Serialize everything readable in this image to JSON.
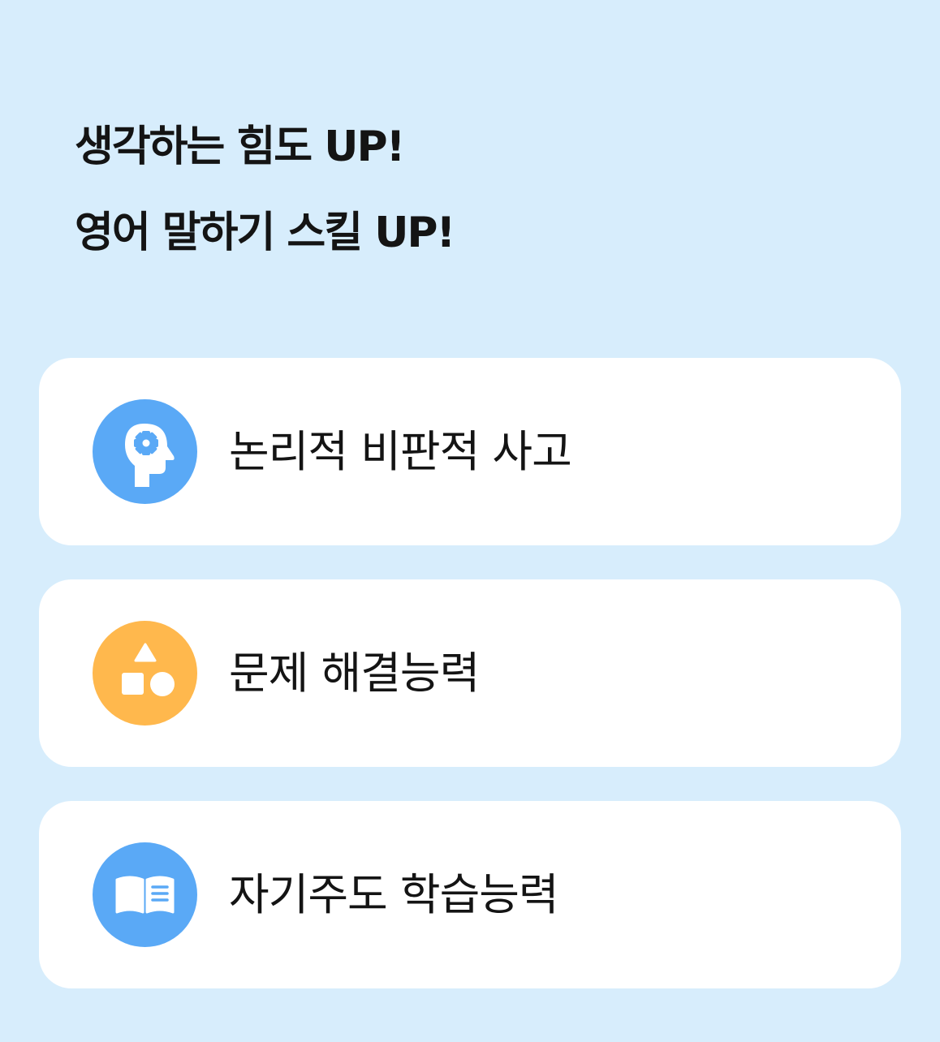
{
  "headline": {
    "line1": "생각하는 힘도 UP!",
    "line2": "영어 말하기 스킬 UP!"
  },
  "colors": {
    "background": "#d7edfc",
    "card": "#ffffff",
    "blue_icon": "#5aa9f6",
    "orange_icon": "#ffb84d"
  },
  "features": [
    {
      "label": "논리적 비판적 사고",
      "icon": "head-gear-icon",
      "color": "#5aa9f6"
    },
    {
      "label": "문제 해결능력",
      "icon": "shapes-icon",
      "color": "#ffb84d"
    },
    {
      "label": "자기주도 학습능력",
      "icon": "open-book-icon",
      "color": "#5aa9f6"
    }
  ]
}
